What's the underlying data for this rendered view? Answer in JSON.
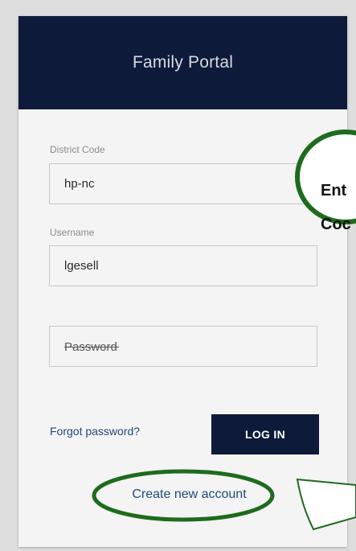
{
  "header": {
    "title": "Family Portal"
  },
  "form": {
    "district_code": {
      "label": "District Code",
      "value": "hp-nc"
    },
    "username": {
      "label": "Username",
      "value": "lgesell"
    },
    "password": {
      "placeholder": "Password"
    },
    "forgot_label": "Forgot password?",
    "login_label": "LOG IN",
    "create_label": "Create new account"
  },
  "annotation": {
    "line1": "Ent",
    "line2": "Coc",
    "color": "#1e6b1e"
  },
  "colors": {
    "header_bg": "#0e1a3a",
    "button_bg": "#0e1a3a",
    "link": "#1e4a7a",
    "card_bg": "#f4f4f4",
    "page_bg": "#dedede"
  }
}
